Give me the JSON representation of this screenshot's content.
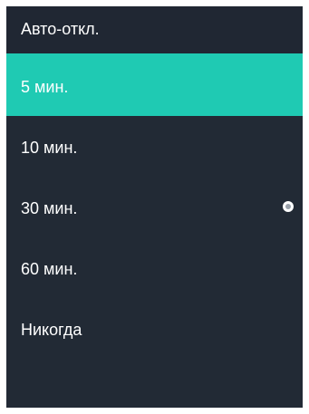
{
  "header": {
    "title": "Авто-откл."
  },
  "menu": {
    "items": [
      {
        "label": "5 мин.",
        "highlighted": true,
        "checked": false
      },
      {
        "label": "10 мин.",
        "highlighted": false,
        "checked": false
      },
      {
        "label": "30 мин.",
        "highlighted": false,
        "checked": true
      },
      {
        "label": "60 мин.",
        "highlighted": false,
        "checked": false
      },
      {
        "label": "Никогда",
        "highlighted": false,
        "checked": false
      }
    ]
  },
  "colors": {
    "panel_background": "#222a35",
    "highlight": "#1fcab3",
    "text": "#ffffff"
  },
  "icons": {
    "selected_marker": "radio-selected-icon"
  }
}
